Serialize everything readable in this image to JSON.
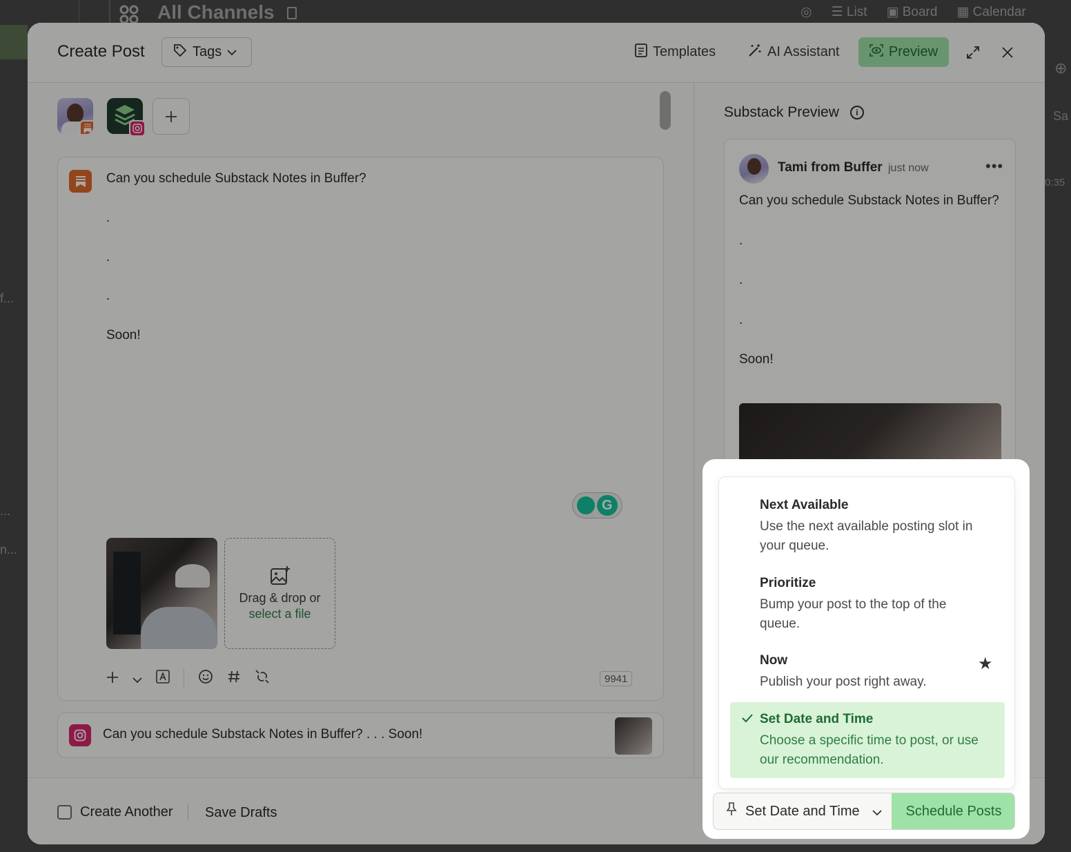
{
  "background": {
    "title": "All Channels",
    "views": [
      "List",
      "Board",
      "Calendar"
    ],
    "sidebar_fragments": [
      "f...",
      "...",
      "n..."
    ],
    "right_fragments": [
      "Sa",
      "0:35"
    ]
  },
  "header": {
    "title": "Create Post",
    "tags_label": "Tags",
    "templates_label": "Templates",
    "ai_label": "AI Assistant",
    "preview_label": "Preview"
  },
  "editor": {
    "lines": [
      "Can you schedule Substack Notes in Buffer?",
      ".",
      ".",
      ".",
      "Soon!"
    ],
    "dropzone_text": "Drag & drop or",
    "dropzone_link": "select a file",
    "char_count": "9941"
  },
  "instagram": {
    "summary": "Can you schedule Substack Notes in Buffer? . . . Soon!"
  },
  "preview": {
    "title": "Substack Preview",
    "author": "Tami from Buffer",
    "time": "just now",
    "lines": [
      "Can you schedule Substack Notes in Buffer?",
      ".",
      ".",
      ".",
      "Soon!"
    ]
  },
  "footer": {
    "create_another": "Create Another",
    "save_drafts": "Save Drafts"
  },
  "schedule": {
    "options": [
      {
        "title": "Next Available",
        "desc": "Use the next available posting slot in your queue."
      },
      {
        "title": "Prioritize",
        "desc": "Bump your post to the top of the queue."
      },
      {
        "title": "Now",
        "desc": "Publish your post right away."
      },
      {
        "title": "Set Date and Time",
        "desc": "Choose a specific time to post, or use our recommendation."
      }
    ],
    "selected": "Set Date and Time",
    "button": "Schedule Posts"
  },
  "colors": {
    "accent_green": "#9fe2a8",
    "accent_green_text": "#1f6b34",
    "selected_bg": "#d9f3d9",
    "substack": "#e0692a",
    "instagram": "#d6266b"
  }
}
